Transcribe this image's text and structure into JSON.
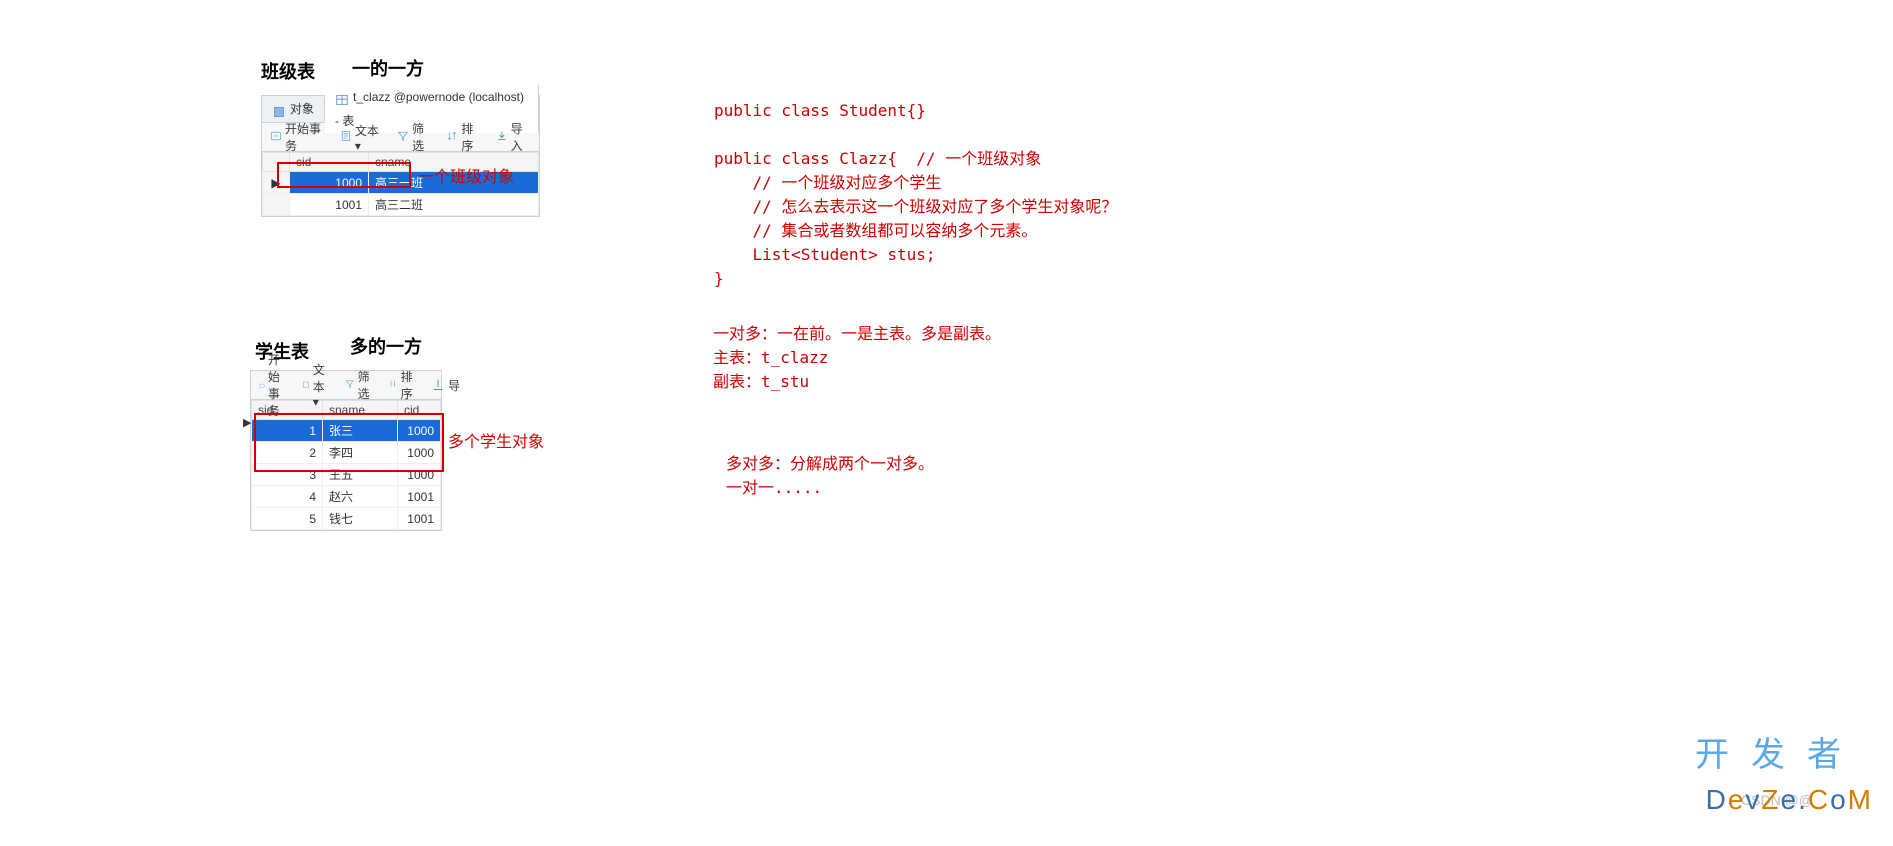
{
  "headings": {
    "class_table": "班级表",
    "one_side": "一的一方",
    "student_table": "学生表",
    "many_side": "多的一方"
  },
  "db1": {
    "tabs": {
      "obj": "对象",
      "active": "t_clazz @powernode (localhost) - 表"
    },
    "toolbar": {
      "start": "开始事务",
      "text": "文本 ▾",
      "filter": "筛选",
      "sort": "排序",
      "import": "导入"
    },
    "cols": {
      "cid": "cid",
      "cname": "cname"
    },
    "rows": [
      {
        "cid": "1000",
        "cname": "高三一班"
      },
      {
        "cid": "1001",
        "cname": "高三二班"
      }
    ]
  },
  "db2": {
    "toolbar": {
      "start": "开始事务",
      "text": "文本 ▾",
      "filter": "筛选",
      "sort": "排序",
      "import": "导"
    },
    "cols": {
      "sid": "sid",
      "sname": "sname",
      "cid": "cid"
    },
    "rows": [
      {
        "sid": "1",
        "sname": "张三",
        "cid": "1000"
      },
      {
        "sid": "2",
        "sname": "李四",
        "cid": "1000"
      },
      {
        "sid": "3",
        "sname": "王五",
        "cid": "1000"
      },
      {
        "sid": "4",
        "sname": "赵六",
        "cid": "1001"
      },
      {
        "sid": "5",
        "sname": "钱七",
        "cid": "1001"
      }
    ]
  },
  "annot": {
    "one_obj": "一个班级对象",
    "many_obj": "多个学生对象"
  },
  "code": {
    "l1": "public class Student{}",
    "l2": "public class Clazz{  // 一个班级对象",
    "l3": "    // 一个班级对应多个学生",
    "l4": "    // 怎么去表示这一个班级对应了多个学生对象呢？",
    "l5": "    // 集合或者数组都可以容纳多个元素。",
    "l6": "    List<Student> stus;",
    "l7": "}"
  },
  "notes1": {
    "l1": "一对多：一在前。一是主表。多是副表。",
    "l2": "主表：t_clazz",
    "l3": "副表：t_stu"
  },
  "notes2": {
    "l1": "多对多：分解成两个一对多。",
    "l2": "一对一....."
  },
  "watermark": {
    "kaifazhe": "开发者",
    "devze": "DevZe.CoM",
    "csdn": "CSDN @@"
  }
}
